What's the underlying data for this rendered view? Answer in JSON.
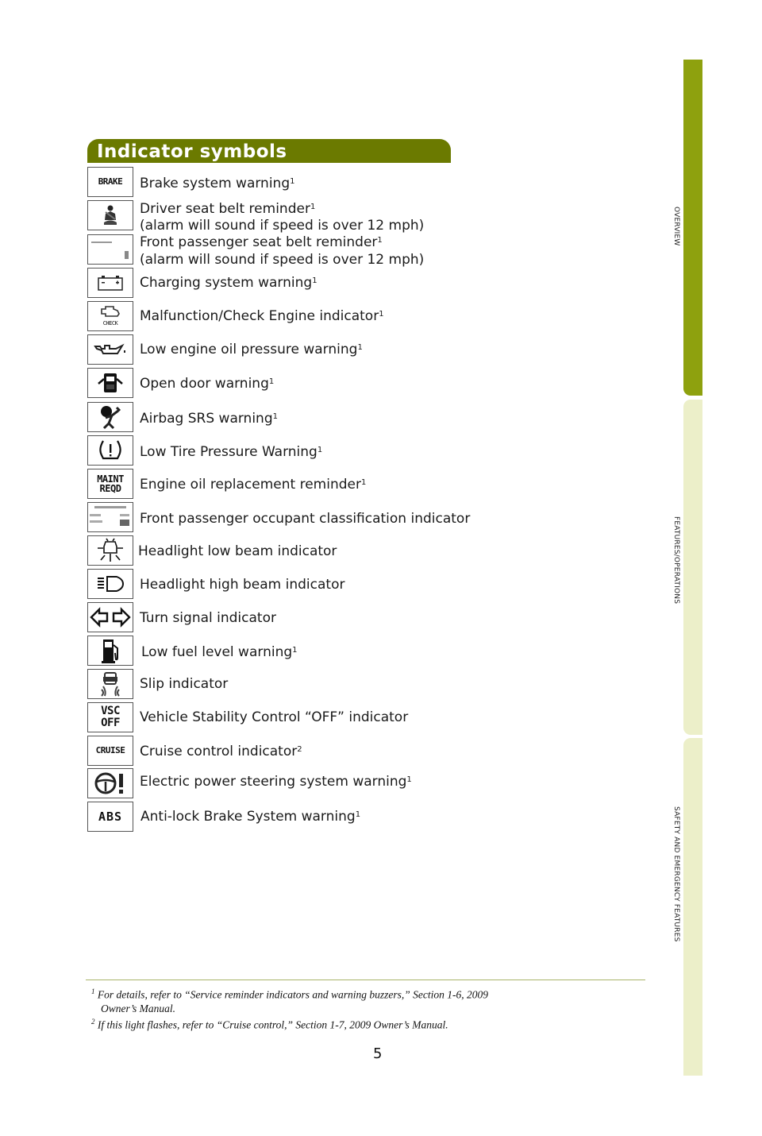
{
  "header": {
    "title": "Indicator symbols"
  },
  "indicators": [
    {
      "icon": "brake-warning-icon",
      "icon_text": "BRAKE",
      "label": "Brake system warning",
      "sup": "1"
    },
    {
      "icon": "driver-seatbelt-icon",
      "label": "Driver seat belt reminder",
      "sup": "1",
      "label2": "(alarm will sound if speed is over 12 mph)"
    },
    {
      "icon": "passenger-seatbelt-icon",
      "label": "Front passenger seat belt reminder",
      "sup": "1",
      "label2": "(alarm will sound if speed is over 12 mph)"
    },
    {
      "icon": "battery-icon",
      "label": "Charging system warning",
      "sup": "1"
    },
    {
      "icon": "check-engine-icon",
      "icon_text": "CHECK",
      "label": "Malfunction/Check Engine indicator",
      "sup": "1"
    },
    {
      "icon": "oil-can-icon",
      "label": "Low engine oil pressure warning",
      "sup": "1"
    },
    {
      "icon": "open-door-icon",
      "label": "Open door warning",
      "sup": "1"
    },
    {
      "icon": "airbag-icon",
      "label": "Airbag SRS warning",
      "sup": "1"
    },
    {
      "icon": "tire-pressure-icon",
      "label": "Low Tire Pressure Warning",
      "sup": "1"
    },
    {
      "icon": "maint-reqd-icon",
      "icon_text": "MAINT",
      "icon_text2": "REQD",
      "label": "Engine oil replacement reminder",
      "sup": "1"
    },
    {
      "icon": "occupant-classification-icon",
      "label": "Front passenger occupant classification indicator",
      "sup": ""
    },
    {
      "icon": "low-beam-icon",
      "label": "Headlight low beam indicator",
      "sup": ""
    },
    {
      "icon": "high-beam-icon",
      "label": "Headlight high beam indicator",
      "sup": ""
    },
    {
      "icon": "turn-signal-icon",
      "label": "Turn signal indicator",
      "sup": ""
    },
    {
      "icon": "fuel-pump-icon",
      "label": "Low fuel level warning",
      "sup": "1"
    },
    {
      "icon": "slip-icon",
      "label": "Slip indicator",
      "sup": ""
    },
    {
      "icon": "vsc-off-icon",
      "icon_text": "VSC",
      "icon_text2": "OFF",
      "label": "Vehicle Stability Control “OFF” indicator",
      "sup": ""
    },
    {
      "icon": "cruise-icon",
      "icon_text": "CRUISE",
      "label": "Cruise control indicator",
      "sup": "2"
    },
    {
      "icon": "power-steering-icon",
      "label": "Electric power steering system warning",
      "sup": "1"
    },
    {
      "icon": "abs-icon",
      "icon_text": "ABS",
      "label": "Anti-lock Brake System warning",
      "sup": "1"
    }
  ],
  "footnotes": [
    {
      "num": "1",
      "text": "For details, refer to “Service reminder indicators and warning buzzers,” Section 1-6, 2009",
      "text2": "Owner’s Manual."
    },
    {
      "num": "2",
      "text": "If this light flashes, refer to “Cruise control,” Section 1-7, 2009 Owner’s Manual."
    }
  ],
  "page_number": "5",
  "side_tabs": [
    {
      "label": "OVERVIEW",
      "active": true
    },
    {
      "label": "FEATURES/OPERATIONS",
      "active": false
    },
    {
      "label": "SAFETY AND EMERGENCY FEATURES",
      "active": false
    }
  ],
  "colors": {
    "header_bg": "#6b7a00",
    "tab_active": "#8ea10e",
    "tab_inactive": "#ecefc9"
  }
}
